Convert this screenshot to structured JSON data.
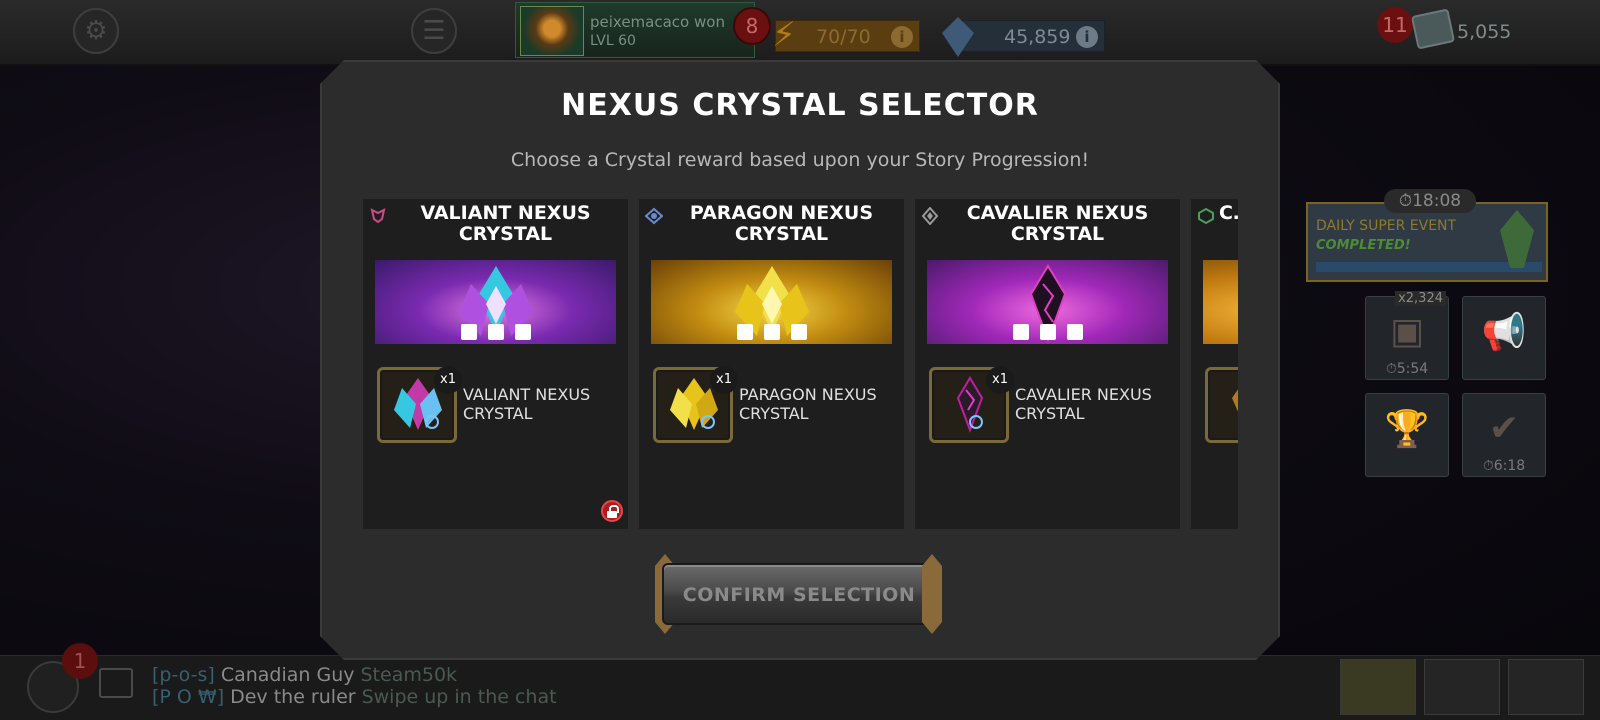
{
  "topbar": {
    "player_name": "peixemacaco won",
    "player_level": "LVL 60",
    "notification_count": "8",
    "energy": "70/70",
    "units": "45,859",
    "gold_badge": "11",
    "gold": "5,055"
  },
  "side": {
    "event_timer": "⏱18:08",
    "event_title": "DAILY SUPER EVENT",
    "event_status": "COMPLETED!",
    "tile_a_count": "x2,324",
    "tile_a_timer": "⏱5:54",
    "tile_d_timer": "⏱6:18"
  },
  "modal": {
    "title": "NEXUS CRYSTAL SELECTOR",
    "subtitle": "Choose a Crystal reward based upon your Story Progression!",
    "confirm_label": "CONFIRM SELECTION",
    "cards": [
      {
        "title": "VALIANT NEXUS CRYSTAL",
        "reward_name": "VALIANT NEXUS CRYSTAL",
        "quantity": "x1",
        "color": "#c23aa8",
        "accent": "#36c8e0"
      },
      {
        "title": "PARAGON NEXUS CRYSTAL",
        "reward_name": "PARAGON NEXUS CRYSTAL",
        "quantity": "x1",
        "color": "#e8c41a",
        "accent": "#f2e04a"
      },
      {
        "title": "CAVALIER NEXUS CRYSTAL",
        "reward_name": "CAVALIER NEXUS CRYSTAL",
        "quantity": "x1",
        "color": "#c01ea0",
        "accent": "#2a1a2a"
      },
      {
        "title": "C… N…",
        "reward_name": "",
        "quantity": "",
        "color": "#e8a01a",
        "accent": "#b07a20"
      }
    ]
  },
  "bottombar": {
    "friends_badge": "1",
    "chat": [
      {
        "tag": "[p-o-s]",
        "name": "Canadian Guy",
        "message": "Steam50k"
      },
      {
        "tag": "[P O ₩]",
        "name": "Dev the ruler",
        "message": "Swipe up in the chat"
      }
    ]
  }
}
